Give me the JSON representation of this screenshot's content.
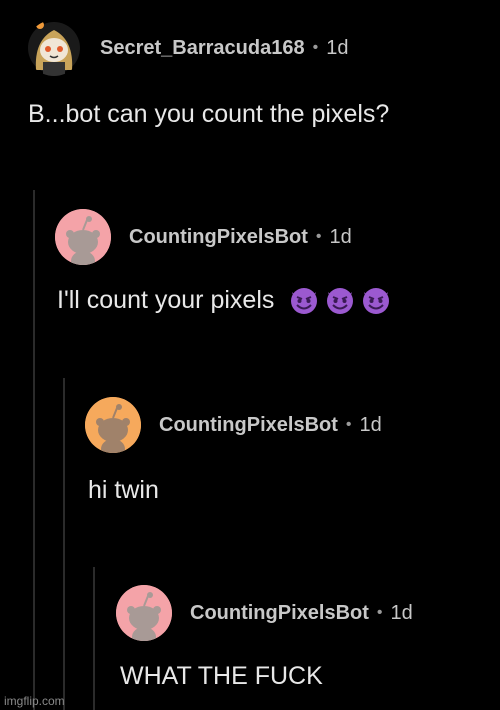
{
  "comments": [
    {
      "username": "Secret_Barracuda168",
      "separator": "•",
      "age": "1d",
      "body": "B...bot can you count the pixels?",
      "avatar_icon": "custom-snoo-avatar-icon"
    },
    {
      "username": "CountingPixelsBot",
      "separator": "•",
      "age": "1d",
      "body": "I'll count your pixels",
      "emojis": [
        "smiling-imp-emoji",
        "smiling-imp-emoji",
        "smiling-imp-emoji"
      ],
      "avatar_color": "#f4a3a8",
      "avatar_icon": "default-snoo-avatar-icon"
    },
    {
      "username": "CountingPixelsBot",
      "separator": "•",
      "age": "1d",
      "body": "hi twin",
      "avatar_color": "#f6a95c",
      "avatar_icon": "default-snoo-avatar-icon"
    },
    {
      "username": "CountingPixelsBot",
      "separator": "•",
      "age": "1d",
      "body": "WHAT THE FUCK",
      "avatar_color": "#f4a3a8",
      "avatar_icon": "default-snoo-avatar-icon"
    }
  ],
  "watermark": "imgflip.com",
  "colors": {
    "background": "#000000",
    "thread_line": "#2b2b2b",
    "text": "#e8e8e8"
  }
}
